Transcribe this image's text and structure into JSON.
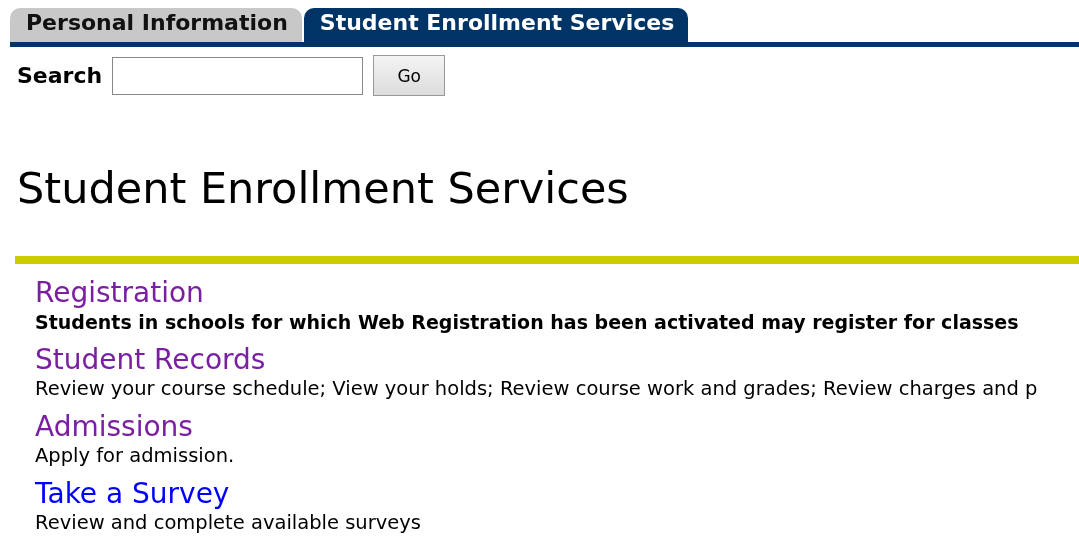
{
  "tabs": [
    {
      "label": "Personal Information",
      "selected": false
    },
    {
      "label": "Student Enrollment Services",
      "selected": true
    }
  ],
  "search": {
    "label": "Search",
    "button": "Go"
  },
  "heading": "Student Enrollment Services",
  "menu": [
    {
      "title": "Registration",
      "visited": true,
      "description": "Students in schools for which Web Registration has been activated may register for classes",
      "bold": true
    },
    {
      "title": "Student Records",
      "visited": true,
      "description": "Review your course schedule; View your holds; Review course work and grades; Review charges and p",
      "bold": false
    },
    {
      "title": "Admissions",
      "visited": true,
      "description": "Apply for admission.",
      "bold": false
    },
    {
      "title": "Take a Survey",
      "visited": false,
      "description": "Review and complete available surveys",
      "bold": false
    }
  ]
}
